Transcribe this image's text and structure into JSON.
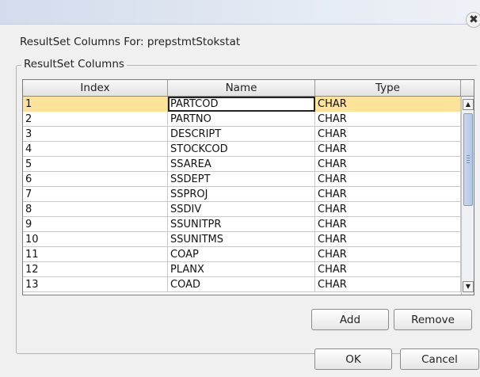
{
  "window": {
    "close_glyph": "✖",
    "label": "ResultSet Columns For: prepstmtStokstat"
  },
  "group": {
    "legend": "ResultSet Columns"
  },
  "table": {
    "headers": [
      "Index",
      "Name",
      "Type"
    ],
    "selected_row": 0,
    "rows": [
      {
        "index": "1",
        "name": "PARTCOD",
        "type": "CHAR"
      },
      {
        "index": "2",
        "name": "PARTNO",
        "type": "CHAR"
      },
      {
        "index": "3",
        "name": "DESCRIPT",
        "type": "CHAR"
      },
      {
        "index": "4",
        "name": "STOCKCOD",
        "type": "CHAR"
      },
      {
        "index": "5",
        "name": "SSAREA",
        "type": "CHAR"
      },
      {
        "index": "6",
        "name": "SSDEPT",
        "type": "CHAR"
      },
      {
        "index": "7",
        "name": "SSPROJ",
        "type": "CHAR"
      },
      {
        "index": "8",
        "name": "SSDIV",
        "type": "CHAR"
      },
      {
        "index": "9",
        "name": "SSUNITPR",
        "type": "CHAR"
      },
      {
        "index": "10",
        "name": "SSUNITMS",
        "type": "CHAR"
      },
      {
        "index": "11",
        "name": "COAP",
        "type": "CHAR"
      },
      {
        "index": "12",
        "name": "PLANX",
        "type": "CHAR"
      },
      {
        "index": "13",
        "name": "COAD",
        "type": "CHAR"
      }
    ],
    "scroll_up_glyph": "▲",
    "scroll_down_glyph": "▼"
  },
  "buttons": {
    "add": "Add",
    "remove": "Remove",
    "ok": "OK",
    "cancel": "Cancel"
  }
}
